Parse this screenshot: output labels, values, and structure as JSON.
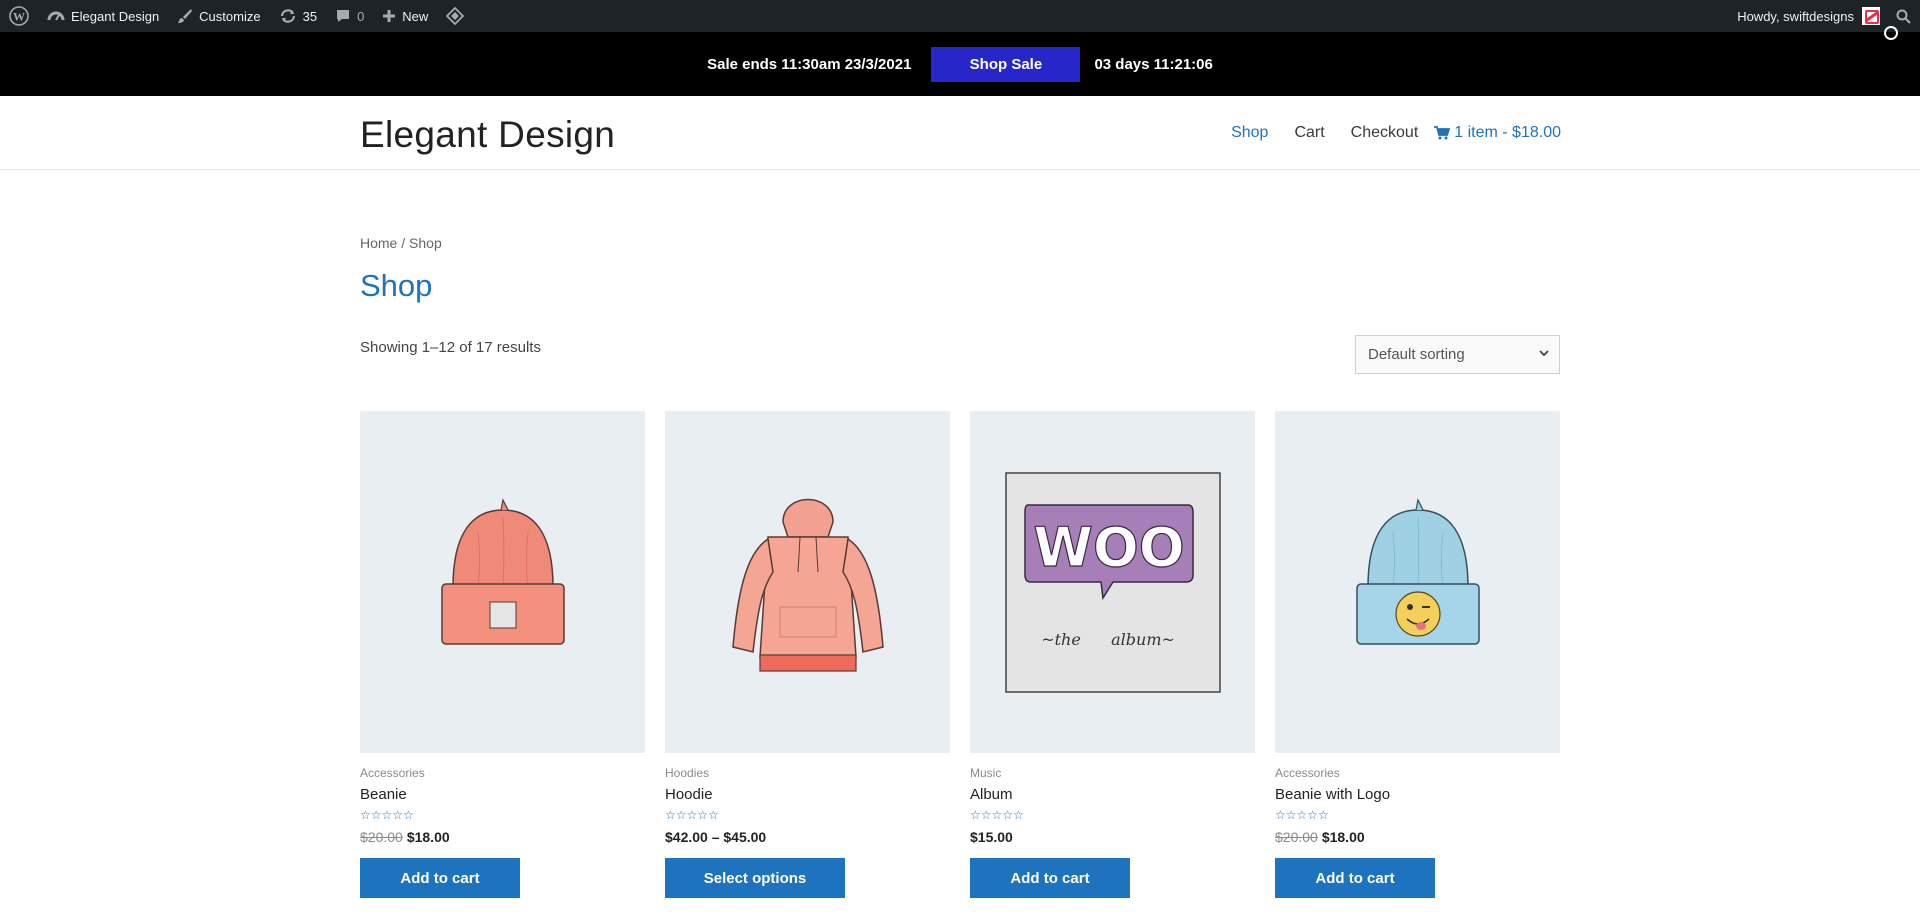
{
  "adminbar": {
    "site_name": "Elegant Design",
    "customize": "Customize",
    "updates_count": "35",
    "comments_count": "0",
    "new_label": "New",
    "greeting": "Howdy, swiftdesigns"
  },
  "sale_banner": {
    "text": "Sale ends 11:30am 23/3/2021",
    "button": "Shop Sale",
    "countdown": "03 days 11:21:06",
    "bg_color": "#000000",
    "button_color": "#2626c9"
  },
  "header": {
    "site_title": "Elegant Design",
    "nav": [
      "Shop",
      "Cart",
      "Checkout"
    ],
    "cart_summary": "1 item - $18.00",
    "accent_color": "#1e73be"
  },
  "breadcrumb": {
    "home": "Home",
    "separator": " / ",
    "current": "Shop"
  },
  "page": {
    "title": "Shop",
    "result_count": "Showing 1–12 of 17 results",
    "sorting": "Default sorting"
  },
  "products": [
    {
      "category": "Accessories",
      "name": "Beanie",
      "old_price": "$20.00",
      "price": "$18.00",
      "button": "Add to cart",
      "rating": "0/5",
      "image": "beanie-red"
    },
    {
      "category": "Hoodies",
      "name": "Hoodie",
      "old_price": "",
      "price": "$42.00 – $45.00",
      "button": "Select options",
      "rating": "0/5",
      "image": "hoodie"
    },
    {
      "category": "Music",
      "name": "Album",
      "old_price": "",
      "price": "$15.00",
      "button": "Add to cart",
      "rating": "0/5",
      "image": "woo-album"
    },
    {
      "category": "Accessories",
      "name": "Beanie with Logo",
      "old_price": "$20.00",
      "price": "$18.00",
      "button": "Add to cart",
      "rating": "0/5",
      "image": "beanie-blue-logo"
    }
  ]
}
